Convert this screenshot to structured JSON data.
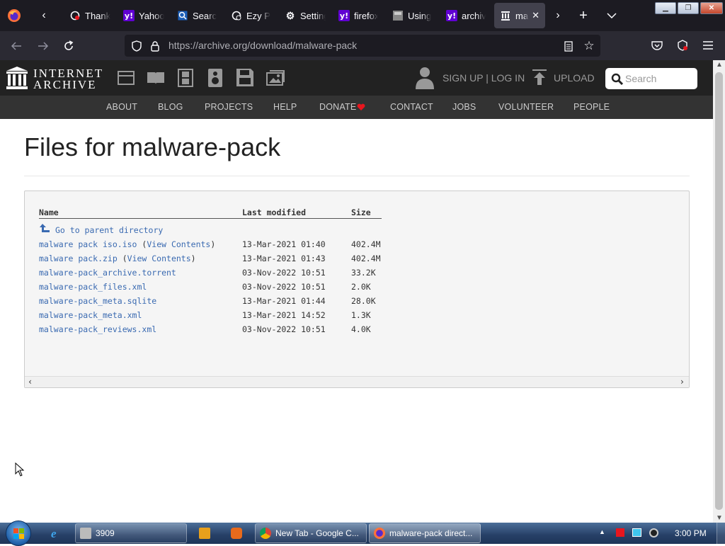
{
  "browser": {
    "tabs": [
      {
        "label": "Thank",
        "icon": "gear-shield-icon"
      },
      {
        "label": "Yahoo",
        "icon": "yahoo-icon"
      },
      {
        "label": "Search",
        "icon": "search-icon"
      },
      {
        "label": "Ezy Pl",
        "icon": "ezy-icon"
      },
      {
        "label": "Setting",
        "icon": "gear-icon"
      },
      {
        "label": "firefox",
        "icon": "yahoo-icon"
      },
      {
        "label": "Using",
        "icon": "page-icon"
      },
      {
        "label": "archiv",
        "icon": "yahoo-icon"
      },
      {
        "label": "ma",
        "icon": "archive-icon",
        "active": true
      }
    ],
    "url_host": "https://archive.org",
    "url_path": "/download/malware-pack"
  },
  "ia": {
    "logo_top": "INTERNET",
    "logo_bottom": "ARCHIVE",
    "signup": "SIGN UP | LOG IN",
    "upload": "UPLOAD",
    "search_placeholder": "Search",
    "menu": [
      "ABOUT",
      "BLOG",
      "PROJECTS",
      "HELP",
      "DONATE",
      "CONTACT",
      "JOBS",
      "VOLUNTEER",
      "PEOPLE"
    ]
  },
  "page": {
    "title": "Files for malware-pack",
    "headers": {
      "name": "Name",
      "modified": "Last modified",
      "size": "Size"
    },
    "parent": "Go to parent directory",
    "files": [
      {
        "name": "malware pack iso.iso",
        "view": "View Contents",
        "modified": "13-Mar-2021 01:40",
        "size": "402.4M"
      },
      {
        "name": "malware pack.zip",
        "view": "View Contents",
        "modified": "13-Mar-2021 01:43",
        "size": "402.4M"
      },
      {
        "name": "malware-pack_archive.torrent",
        "view": "",
        "modified": "03-Nov-2022 10:51",
        "size": "33.2K"
      },
      {
        "name": "malware-pack_files.xml",
        "view": "",
        "modified": "03-Nov-2022 10:51",
        "size": "2.0K"
      },
      {
        "name": "malware-pack_meta.sqlite",
        "view": "",
        "modified": "13-Mar-2021 01:44",
        "size": "28.0K"
      },
      {
        "name": "malware-pack_meta.xml",
        "view": "",
        "modified": "13-Mar-2021 14:52",
        "size": "1.3K"
      },
      {
        "name": "malware-pack_reviews.xml",
        "view": "",
        "modified": "03-Nov-2022 10:51",
        "size": "4.0K"
      }
    ]
  },
  "taskbar": {
    "items": [
      {
        "label": "3909"
      },
      {
        "label": "New Tab - Google C..."
      },
      {
        "label": "malware-pack direct..."
      }
    ],
    "clock": "3:00 PM"
  },
  "colors": {
    "link": "#3a6ab1",
    "ia_header": "#222222",
    "ia_menu": "#333333",
    "donate_heart": "#e8161e"
  }
}
